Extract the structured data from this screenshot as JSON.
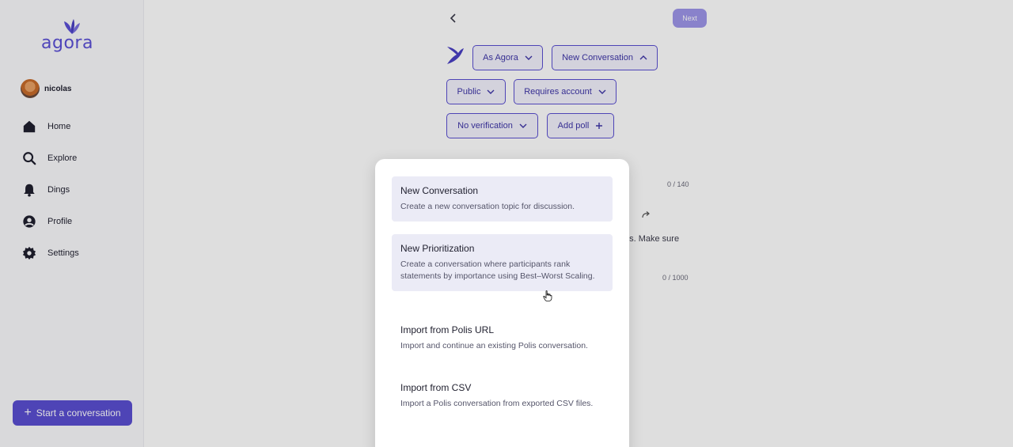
{
  "brand": {
    "name": "agora",
    "color": "#5b50d6"
  },
  "user": {
    "name": "nicolas"
  },
  "sidebar": {
    "items": [
      {
        "label": "Home",
        "icon": "home-icon"
      },
      {
        "label": "Explore",
        "icon": "search-icon"
      },
      {
        "label": "Dings",
        "icon": "bell-icon"
      },
      {
        "label": "Profile",
        "icon": "user-circle-icon"
      },
      {
        "label": "Settings",
        "icon": "gear-icon"
      }
    ],
    "start_label": "Start a conversation"
  },
  "header": {
    "next_label": "Next"
  },
  "selectors": {
    "author": "As Agora",
    "type": "New Conversation",
    "visibility": "Public",
    "access": "Requires account",
    "verification": "No verification",
    "poll": "Add poll"
  },
  "form": {
    "title_count": "0 / 140",
    "body_count": "0 / 1000",
    "partial_text": "es. Make sure"
  },
  "dropdown": {
    "options": [
      {
        "title": "New Conversation",
        "desc": "Create a new conversation topic for discussion."
      },
      {
        "title": "New Prioritization",
        "desc": "Create a conversation where participants rank statements by importance using Best–Worst Scaling."
      },
      {
        "title": "Import from Polis URL",
        "desc": "Import and continue an existing Polis conversation."
      },
      {
        "title": "Import from CSV",
        "desc": "Import a Polis conversation from exported CSV files."
      }
    ]
  },
  "colors": {
    "accent": "#5a4fd1",
    "pill_bg": "#f3f2fd",
    "highlight": "#ebebf6"
  }
}
